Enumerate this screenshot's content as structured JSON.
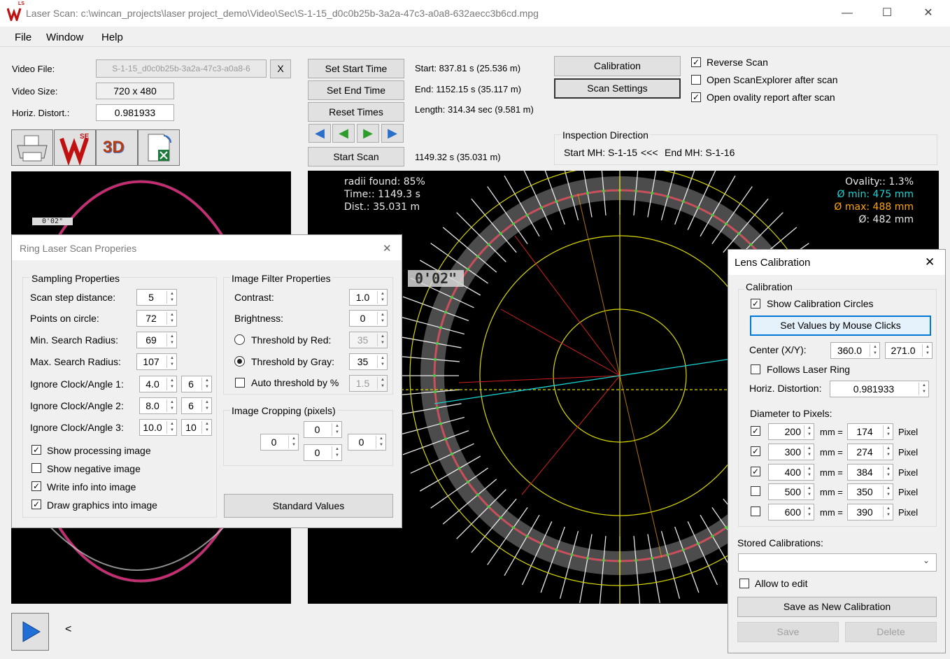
{
  "window": {
    "title": "Laser Scan: c:\\wincan_projects\\laser project_demo\\Video\\Sec\\S-1-15_d0c0b25b-3a2a-47c3-a0a8-632aecc3b6cd.mpg",
    "logo_text": "LS",
    "controls": {
      "minimize": "—",
      "maximize": "☐",
      "close": "✕"
    }
  },
  "menu": [
    "File",
    "Window",
    "Help"
  ],
  "video": {
    "file_label": "Video File:",
    "file_value": "S-1-15_d0c0b25b-3a2a-47c3-a0a8-6",
    "clear_label": "X",
    "size_label": "Video Size:",
    "size_value": "720 x 480",
    "distort_label": "Horiz. Distort.:",
    "distort_value": "0.981933"
  },
  "tools": {
    "se_badge": "SE",
    "three_d_label": "3D"
  },
  "timing": {
    "set_start": "Set Start Time",
    "set_end": "Set End Time",
    "reset": "Reset Times",
    "start_scan": "Start Scan",
    "start_info": "Start: 837.81 s  (25.536 m)",
    "end_info": "End: 1152.15 s  (35.117 m)",
    "length_info": "Length: 314.34 sec (9.581 m)",
    "current_info": "1149.32 s  (35.031 m)"
  },
  "actions": {
    "calibration": "Calibration",
    "scan_settings": "Scan Settings"
  },
  "options": [
    {
      "label": "Reverse Scan",
      "checked": true
    },
    {
      "label": "Open ScanExplorer after scan",
      "checked": false
    },
    {
      "label": "Open ovality report after scan",
      "checked": true
    }
  ],
  "inspection": {
    "title": "Inspection Direction",
    "start": "Start MH: S-1-15",
    "arrows": "<<<",
    "end": "End MH: S-1-16"
  },
  "preview": {
    "counter": "0'02\""
  },
  "scan_view": {
    "radii_found": "radii found: 85%",
    "time": "Time:: 1149.3 s",
    "dist": "Dist.: 35.031 m",
    "ovality": "Ovality:: 1.3%",
    "min": "Ø min: 475 mm",
    "max": "Ø max: 488 mm",
    "diameter": "Ø: 482 mm",
    "counter": "0'02\"",
    "colors": {
      "min": "#19d3d3",
      "max": "#ffa500",
      "ring": "#e05060",
      "grid": "#d8d800"
    }
  },
  "ring_dialog": {
    "title": "Ring Laser Scan Properies",
    "close": "✕",
    "sampling": {
      "title": "Sampling Properties",
      "rows": [
        {
          "label": "Scan step distance:",
          "value": "5"
        },
        {
          "label": "Points on circle:",
          "value": "72"
        },
        {
          "label": "Min. Search Radius:",
          "value": "69"
        },
        {
          "label": "Max. Search Radius:",
          "value": "107"
        },
        {
          "label": "Ignore Clock/Angle 1:",
          "value": "4.0",
          "value2": "6"
        },
        {
          "label": "Ignore Clock/Angle 2:",
          "value": "8.0",
          "value2": "6"
        },
        {
          "label": "Ignore Clock/Angle 3:",
          "value": "10.0",
          "value2": "10"
        }
      ],
      "checks": [
        {
          "label": "Show processing image",
          "checked": true
        },
        {
          "label": "Show negative image",
          "checked": false
        },
        {
          "label": "Write info into image",
          "checked": true
        },
        {
          "label": "Draw graphics into image",
          "checked": true
        }
      ]
    },
    "filter": {
      "title": "Image Filter Properties",
      "contrast_label": "Contrast:",
      "contrast": "1.0",
      "brightness_label": "Brightness:",
      "brightness": "0",
      "red_label": "Threshold by Red:",
      "red_value": "35",
      "gray_label": "Threshold by Gray:",
      "gray_value": "35",
      "auto_label": "Auto threshold by %",
      "auto_value": "1.5"
    },
    "cropping": {
      "title": "Image Cropping (pixels)",
      "top": "0",
      "left": "0",
      "bottom": "0",
      "right": "0"
    },
    "standard": "Standard Values"
  },
  "lens_dialog": {
    "title": "Lens Calibration",
    "close": "✕",
    "group": "Calibration",
    "show_circles": "Show Calibration Circles",
    "set_values": "Set Values by Mouse Clicks",
    "center_label": "Center (X/Y):",
    "center_x": "360.0",
    "center_y": "271.0",
    "follows": "Follows Laser Ring",
    "horiz_label": "Horiz. Distortion:",
    "horiz_value": "0.981933",
    "d2p_label": "Diameter to Pixels:",
    "mm": "mm =",
    "pixel": "Pixel",
    "rows": [
      {
        "checked": true,
        "mm": "200",
        "px": "174"
      },
      {
        "checked": true,
        "mm": "300",
        "px": "274"
      },
      {
        "checked": true,
        "mm": "400",
        "px": "384"
      },
      {
        "checked": false,
        "mm": "500",
        "px": "350"
      },
      {
        "checked": false,
        "mm": "600",
        "px": "390"
      }
    ],
    "stored_label": "Stored Calibrations:",
    "stored_value": "",
    "allow_edit": "Allow to edit",
    "save_new": "Save as New Calibration",
    "save": "Save",
    "delete": "Delete"
  },
  "player": {
    "collapse": "<"
  }
}
